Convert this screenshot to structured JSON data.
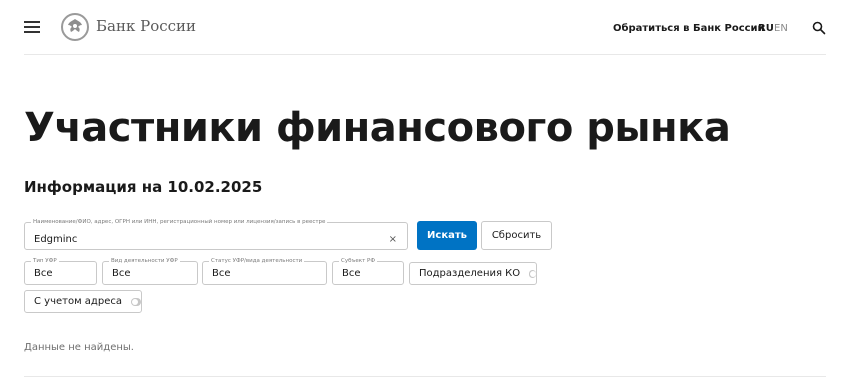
{
  "header": {
    "logo_text": "Банк России",
    "contact_link": "Обратиться в Банк России",
    "lang_ru": "RU",
    "lang_en": "EN"
  },
  "page": {
    "title": "Участники финансового рынка",
    "info_date": "Информация на 10.02.2025"
  },
  "search": {
    "label": "Наименование/ФИО, адрес, ОГРН или ИНН, регистрационный номер или лицензия/запись в реестре",
    "value": "Edgminc",
    "clear": "×",
    "submit_label": "Искать",
    "reset_label": "Сбросить"
  },
  "filters": {
    "type": {
      "label": "Тип УФР",
      "value": "Все"
    },
    "activity": {
      "label": "Вид деятельности УФР",
      "value": "Все"
    },
    "status": {
      "label": "Статус УФР/вида деятельности",
      "value": "Все"
    },
    "subject": {
      "label": "Субъект РФ",
      "value": "Все"
    },
    "ko_divisions": {
      "label": "Подразделения КО",
      "enabled": false
    },
    "with_address": {
      "label": "С учетом адреса",
      "enabled": false
    }
  },
  "results": {
    "message": "Данные не найдены."
  }
}
